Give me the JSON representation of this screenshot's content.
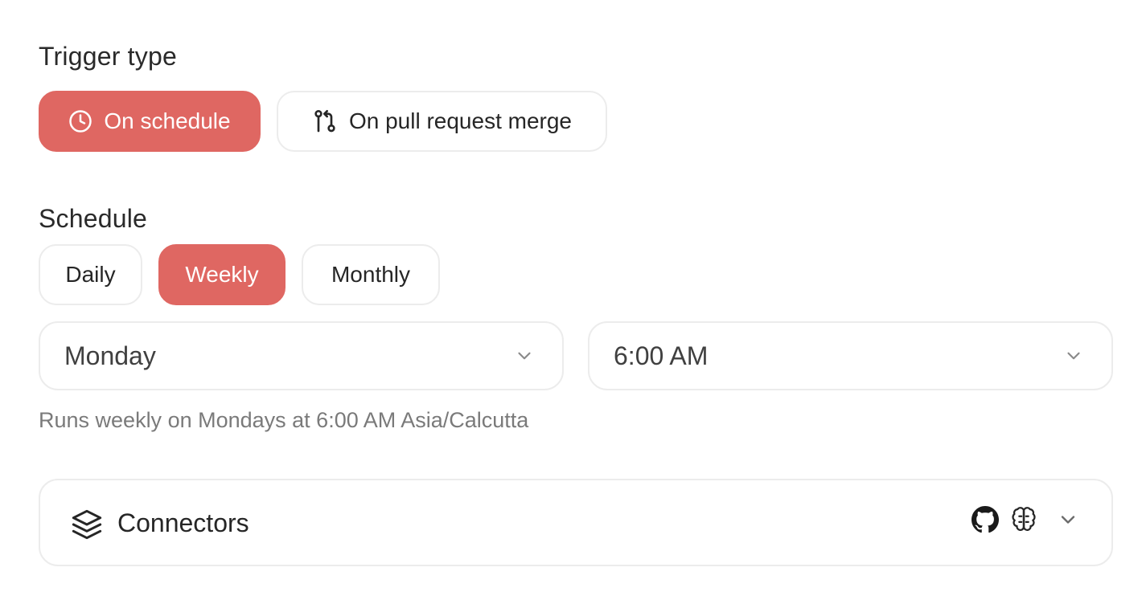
{
  "trigger": {
    "title": "Trigger type",
    "options": [
      {
        "label": "On schedule",
        "icon": "clock-icon",
        "active": true
      },
      {
        "label": "On pull request merge",
        "icon": "git-pull-request-icon",
        "active": false
      }
    ]
  },
  "schedule": {
    "title": "Schedule",
    "frequencies": [
      {
        "label": "Daily",
        "active": false
      },
      {
        "label": "Weekly",
        "active": true
      },
      {
        "label": "Monthly",
        "active": false
      }
    ],
    "day_select": {
      "value": "Monday"
    },
    "time_select": {
      "value": "6:00 AM"
    },
    "summary": "Runs weekly on Mondays at 6:00 AM Asia/Calcutta"
  },
  "connectors": {
    "label": "Connectors",
    "icons": [
      "github-icon",
      "brain-icon"
    ]
  },
  "colors": {
    "accent": "#df6762",
    "border": "#ececec",
    "muted_text": "#7a7a7a"
  }
}
